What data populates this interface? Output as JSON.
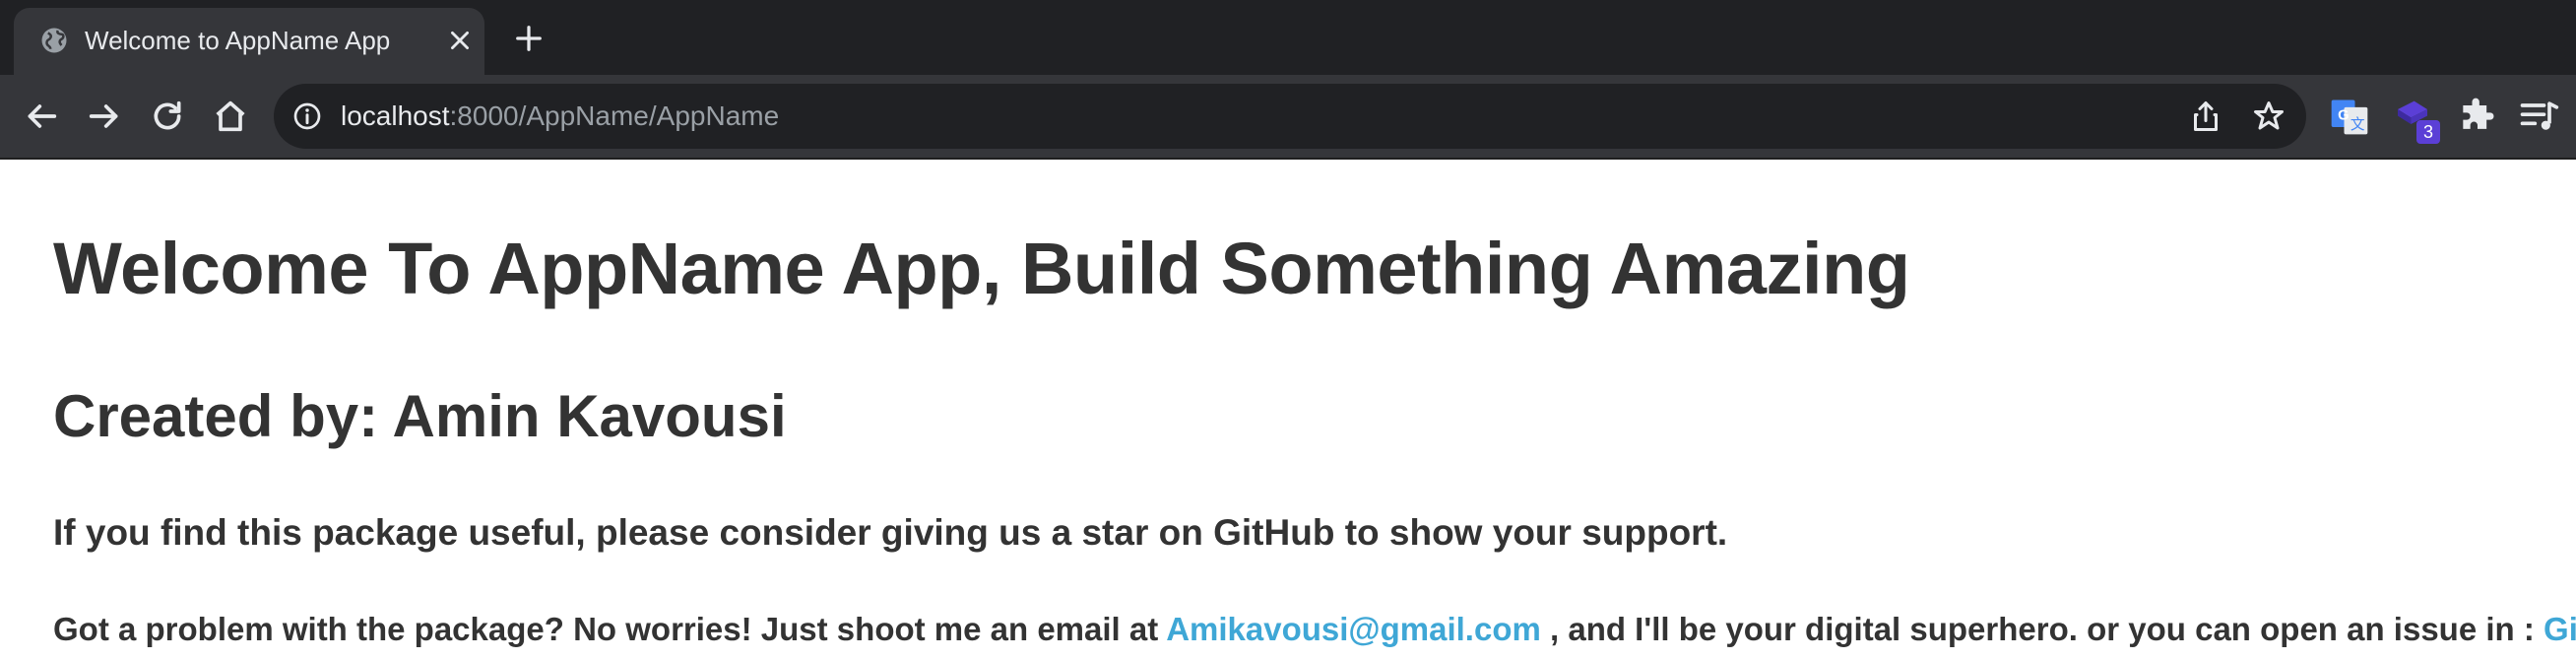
{
  "browser": {
    "tab_title": "Welcome to AppName App",
    "url_host": "localhost",
    "url_path": ":8000/AppName/AppName",
    "extension_badge": "3"
  },
  "page": {
    "heading": "Welcome To AppName App, Build Something Amazing",
    "creator": "Created by: Amin Kavousi",
    "support_text": "If you find this package useful, please consider giving us a star on GitHub to show your support.",
    "problem_prefix": "Got a problem with the package? No worries! Just shoot me an email at",
    "email_link": "Amikavousi@gmail.com",
    "problem_middle": ", and I'll be your digital superhero. or you can open an issue in :",
    "github_link": "GitHub"
  },
  "colors": {
    "text": "#333333",
    "link": "#3fa7d6",
    "chrome_dark": "#202124",
    "chrome_toolbar": "#35363a"
  },
  "icons": [
    "globe-icon",
    "close-icon",
    "plus-icon",
    "back-arrow-icon",
    "forward-arrow-icon",
    "reload-icon",
    "home-icon",
    "info-icon",
    "share-icon",
    "star-icon",
    "translate-icon",
    "extension-icon",
    "puzzle-icon",
    "media-icon"
  ]
}
